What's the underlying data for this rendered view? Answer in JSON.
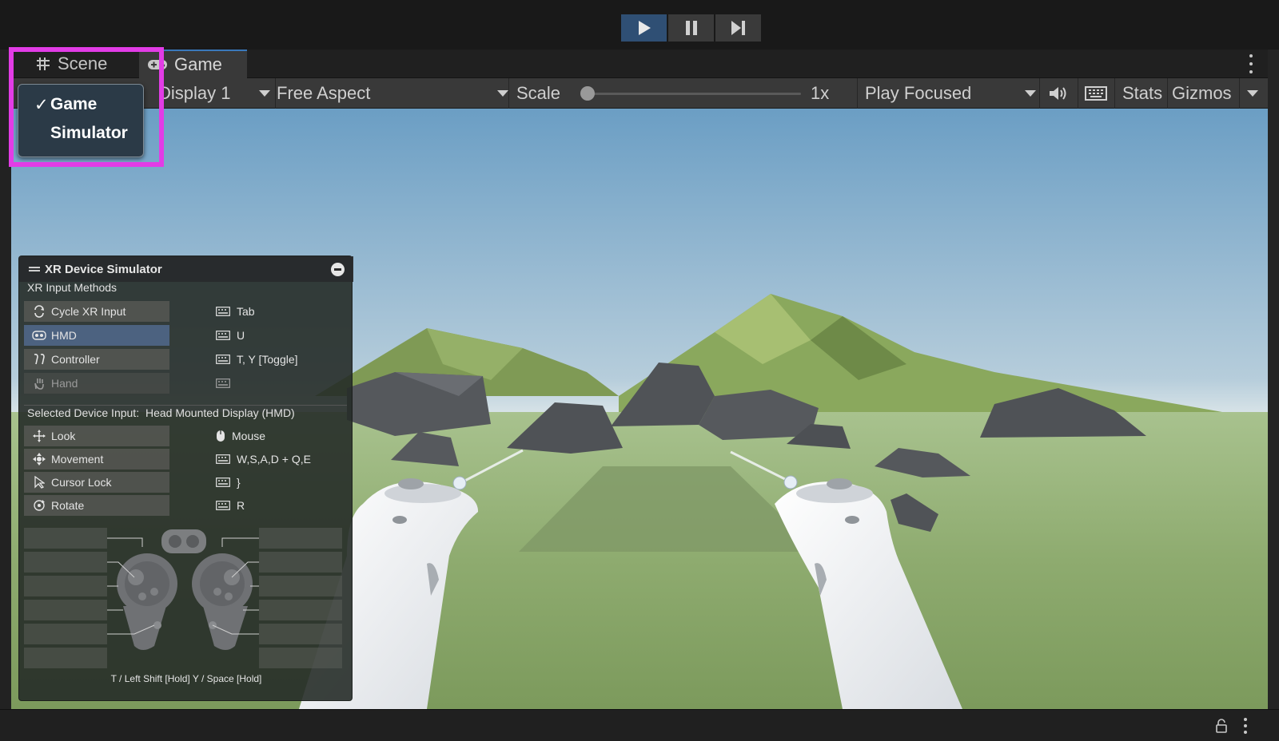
{
  "playbar": {
    "buttons": [
      {
        "name": "play-button",
        "icon": "play-icon",
        "active": true
      },
      {
        "name": "pause-button",
        "icon": "pause-icon",
        "active": false
      },
      {
        "name": "step-button",
        "icon": "step-icon",
        "active": false
      }
    ]
  },
  "tabs": {
    "scene_label": "Scene",
    "game_label": "Game"
  },
  "controls": {
    "display": "Display 1",
    "aspect": "Free Aspect",
    "scale_label": "Scale",
    "scale_value": "1x",
    "play_mode": "Play Focused",
    "stats": "Stats",
    "gizmos": "Gizmos"
  },
  "view_dropdown": {
    "items": [
      {
        "label": "Game",
        "checked": true
      },
      {
        "label": "Simulator",
        "checked": false
      }
    ],
    "highlight_color": "#e23ce6"
  },
  "xr_simulator": {
    "title": "XR Device Simulator",
    "section_input_methods": "XR Input Methods",
    "methods": [
      {
        "label": "Cycle XR Input",
        "key": "Tab",
        "state": "normal"
      },
      {
        "label": "HMD",
        "key": "U",
        "state": "selected"
      },
      {
        "label": "Controller",
        "key": "T, Y [Toggle]",
        "state": "normal"
      },
      {
        "label": "Hand",
        "key": "",
        "state": "disabled"
      }
    ],
    "selected_device_label": "Selected Device Input:",
    "selected_device_value": "Head Mounted Display (HMD)",
    "controls": [
      {
        "label": "Look",
        "key": "Mouse",
        "key_icon": "mouse-icon"
      },
      {
        "label": "Movement",
        "key": "W,S,A,D + Q,E",
        "key_icon": "keyboard-icon"
      },
      {
        "label": "Cursor Lock",
        "key": "}",
        "key_icon": "keyboard-icon"
      },
      {
        "label": "Rotate",
        "key": "R",
        "key_icon": "keyboard-icon"
      }
    ],
    "footer": "T / Left Shift [Hold]  Y / Space [Hold]"
  },
  "colors": {
    "accent_blue": "#3a79bb",
    "play_active": "#2f4f74",
    "sky_top": "#6ea1c6",
    "ground": "#8fae72"
  }
}
